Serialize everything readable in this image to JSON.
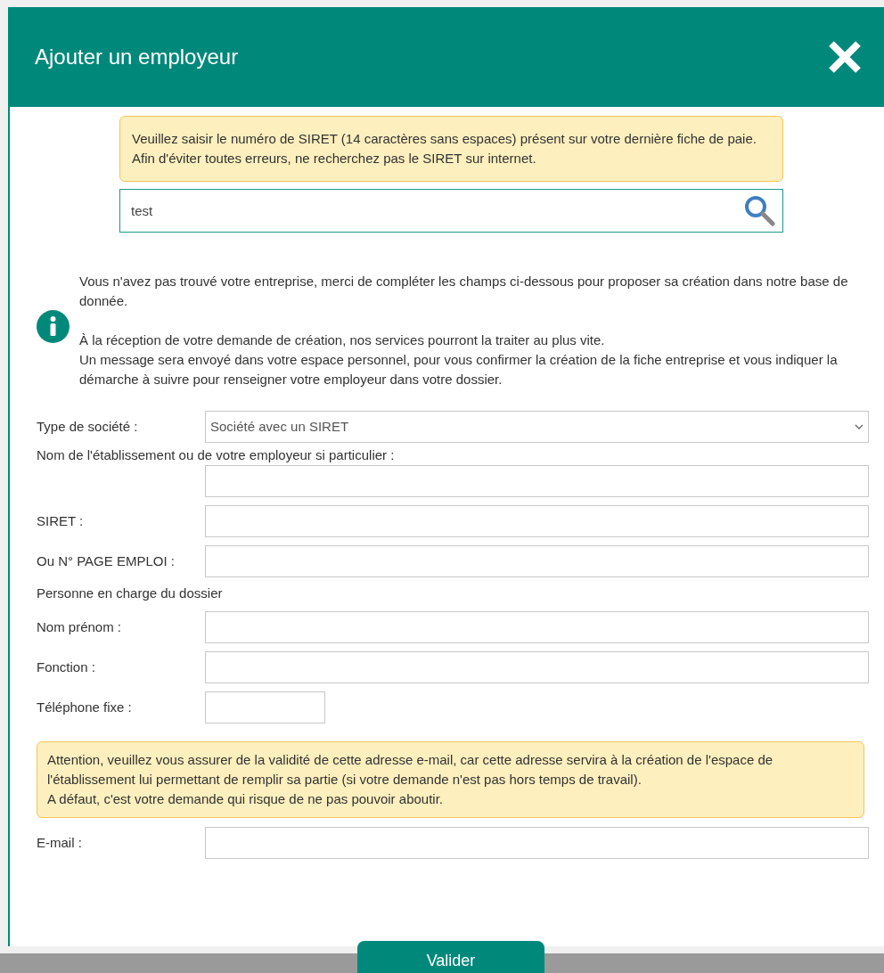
{
  "dialog": {
    "title": "Ajouter un employeur"
  },
  "siret_notice": "Veuillez saisir le numéro de SIRET (14 caractères sans espaces) présent sur votre dernière fiche de paie. Afin d'éviter toutes erreurs, ne recherchez pas le SIRET sur internet.",
  "search": {
    "value": "test"
  },
  "info": {
    "paragraphs": [
      "Vous n'avez pas trouvé votre entreprise, merci de compléter les champs ci-dessous pour proposer sa création dans notre base de donnée.",
      "À la réception de votre demande de création, nos services pourront la traiter au plus vite.\nUn message sera envoyé dans votre espace personnel, pour vous confirmer la création de la fiche entreprise et vous indiquer la démarche à suivre pour renseigner votre employeur dans votre dossier."
    ]
  },
  "fields": [
    {
      "kind": "select",
      "label": "Type de société :",
      "value": "Société avec un SIRET"
    },
    {
      "kind": "stacked",
      "label": "Nom de l'établissement ou de votre employeur si particulier :"
    },
    {
      "kind": "input",
      "label": "SIRET :"
    },
    {
      "kind": "input",
      "label": "Ou N° PAGE EMPLOI :"
    },
    {
      "kind": "heading",
      "label": "Personne en charge du dossier"
    },
    {
      "kind": "input",
      "label": "Nom prénom :"
    },
    {
      "kind": "input",
      "label": "Fonction :"
    },
    {
      "kind": "short",
      "label": "Téléphone fixe :"
    }
  ],
  "email_notice": "Attention, veuillez vous assurer de la validité de cette adresse e-mail, car cette adresse servira à la création de l'espace de l'établissement lui permettant de remplir sa partie (si votre demande n'est pas hors temps de travail).\nA défaut, c'est votre demande qui risque de ne pas pouvoir aboutir.",
  "email_field": {
    "label": "E-mail :"
  },
  "submit": "Valider"
}
